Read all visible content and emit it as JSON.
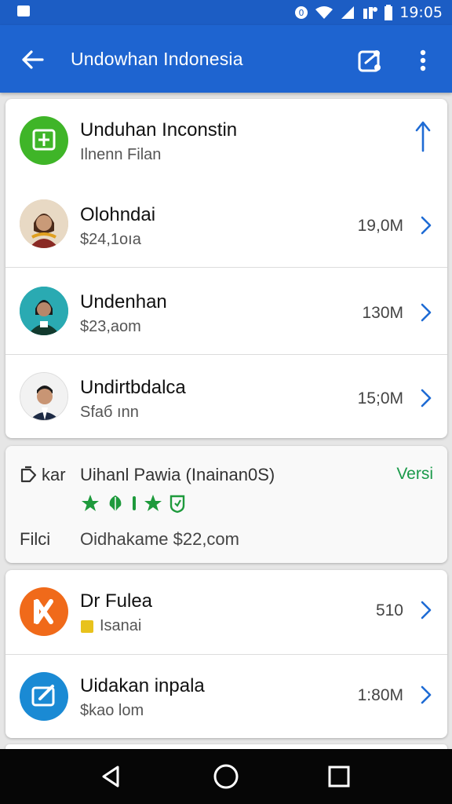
{
  "status_bar": {
    "time": "19:05",
    "icons": [
      "gallery-icon",
      "vpn-icon",
      "wifi-icon",
      "signal-icon",
      "notification-icon",
      "battery-icon"
    ]
  },
  "app_bar": {
    "title": "Undowhan Indonesia",
    "icons": [
      "back-arrow-icon",
      "share-icon",
      "more-vert-icon"
    ]
  },
  "download_list": {
    "header": {
      "title": "Unduhan Inconstin",
      "subtitle": "Ilnenn Filan",
      "icon": "upload-arrow-icon"
    },
    "items": [
      {
        "title": "Olohndai",
        "subtitle": "$24,1oıa",
        "size": "19,0M"
      },
      {
        "title": "Undenhan",
        "subtitle": "$23,aom",
        "size": "130M"
      },
      {
        "title": "Undirtbdalca",
        "subtitle": "Sfaб ınn",
        "size": "15;0M"
      }
    ]
  },
  "info_card": {
    "label1": "kar",
    "title": "Uihanl Pawia (Inainan0S)",
    "version": "Versi",
    "label2": "Filci",
    "detail": "Oidhakame $22,com",
    "rating_icons": [
      "star-icon",
      "leaf-icon",
      "star-icon",
      "shield-icon"
    ]
  },
  "app_list": {
    "items": [
      {
        "title": "Dr Fulea",
        "subtitle": "Isanai",
        "size": "510",
        "icon": "x-logo-icon"
      },
      {
        "title": "Uidakan inpala",
        "subtitle": "$kao lom",
        "size": "1:80M",
        "icon": "edit-box-icon"
      }
    ]
  },
  "colors": {
    "primary": "#1e64d0",
    "status_bar": "#1c5dc4",
    "accent_blue": "#1e6bd4",
    "green": "#1a9a4a",
    "orange": "#f06a1a"
  }
}
